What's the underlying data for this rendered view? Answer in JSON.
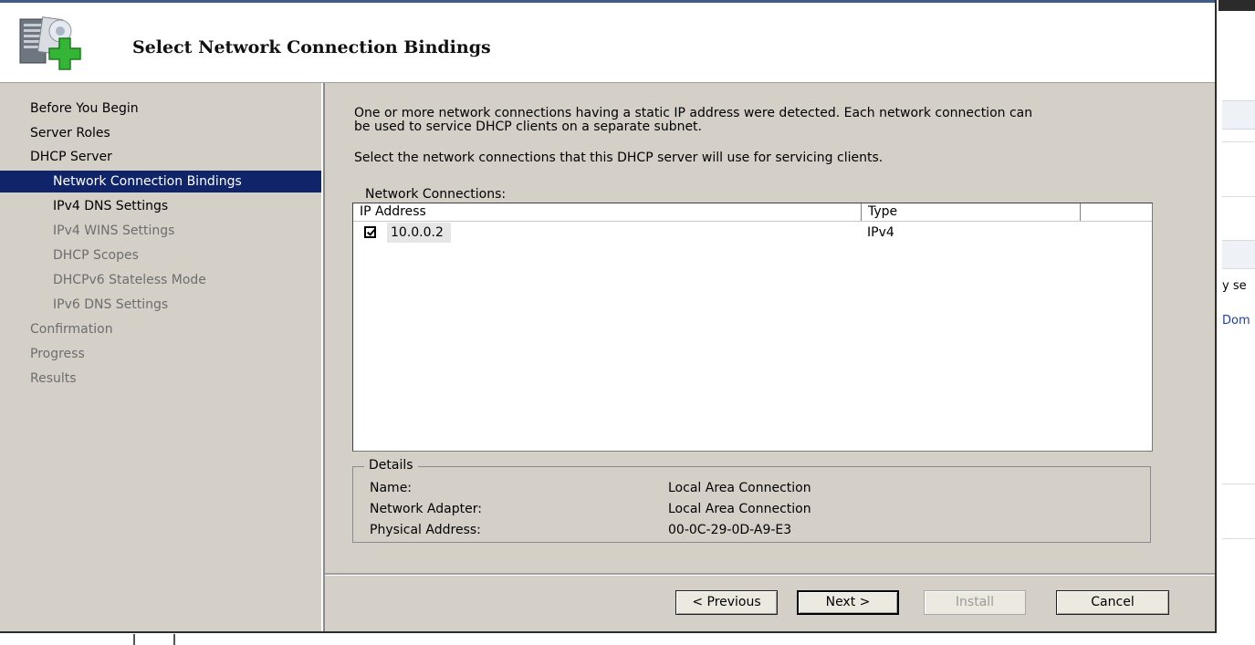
{
  "header": {
    "title": "Select Network Connection Bindings",
    "icon": "server-add-icon"
  },
  "nav": {
    "items": [
      {
        "label": "Before You Begin",
        "state": "enabled",
        "level": 0
      },
      {
        "label": "Server Roles",
        "state": "enabled",
        "level": 0
      },
      {
        "label": "DHCP Server",
        "state": "enabled",
        "level": 0
      },
      {
        "label": "Network Connection Bindings",
        "state": "selected",
        "level": 1
      },
      {
        "label": "IPv4 DNS Settings",
        "state": "enabled",
        "level": 1
      },
      {
        "label": "IPv4 WINS Settings",
        "state": "disabled",
        "level": 1
      },
      {
        "label": "DHCP Scopes",
        "state": "disabled",
        "level": 1
      },
      {
        "label": "DHCPv6 Stateless Mode",
        "state": "disabled",
        "level": 1
      },
      {
        "label": "IPv6 DNS Settings",
        "state": "disabled",
        "level": 1
      },
      {
        "label": "Confirmation",
        "state": "disabled",
        "level": 0
      },
      {
        "label": "Progress",
        "state": "disabled",
        "level": 0
      },
      {
        "label": "Results",
        "state": "disabled",
        "level": 0
      }
    ]
  },
  "content": {
    "intro_line1": "One or more network connections having a static IP address were detected. Each network connection can",
    "intro_line2": "be used to service DHCP clients on a separate subnet.",
    "instruction": "Select the network connections that this DHCP server will use for servicing clients.",
    "list_label": "Network Connections:",
    "columns": [
      "IP Address",
      "Type"
    ],
    "rows": [
      {
        "ip": "10.0.0.2",
        "type": "IPv4",
        "checked": true
      }
    ]
  },
  "details": {
    "legend": "Details",
    "fields": [
      {
        "label": "Name:",
        "value": "Local Area Connection"
      },
      {
        "label": "Network Adapter:",
        "value": "Local Area Connection"
      },
      {
        "label": "Physical Address:",
        "value": "00-0C-29-0D-A9-E3"
      }
    ]
  },
  "buttons": {
    "previous": "< Previous",
    "next": "Next >",
    "install": "Install",
    "cancel": "Cancel"
  },
  "background_window": {
    "text1": "y se",
    "text2": "Dom"
  }
}
